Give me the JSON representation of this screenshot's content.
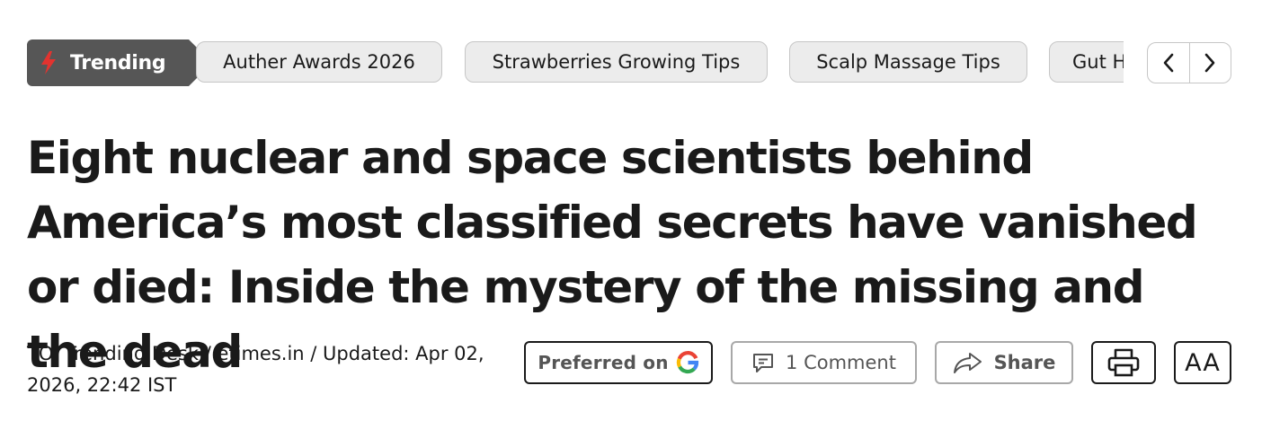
{
  "trending": {
    "label": "Trending",
    "tags": [
      "Auther Awards 2026",
      "Strawberries Growing Tips",
      "Scalp Massage Tips",
      "Gut H"
    ]
  },
  "headline": "Eight nuclear and space scientists behind America’s most classified secrets have vanished or died: Inside the mystery of the missing and the dead",
  "byline": "TOI Trending Desk / etimes.in / Updated: Apr 02, 2026, 22:42 IST",
  "actions": {
    "preferred_label": "Preferred on",
    "comment_label": "1 Comment",
    "share_label": "Share",
    "font_size_label": "AA"
  },
  "icons": {
    "trending": "lightning-bolt-icon",
    "prev": "chevron-left-icon",
    "next": "chevron-right-icon",
    "google": "google-g-icon",
    "comment": "comment-icon",
    "share": "share-arrow-icon",
    "print": "printer-icon"
  },
  "colors": {
    "trending_badge_bg": "#565656",
    "bolt": "#e2332f",
    "tag_bg": "#ececec",
    "tag_border": "#c6c6c6",
    "text": "#1a1a1a"
  }
}
